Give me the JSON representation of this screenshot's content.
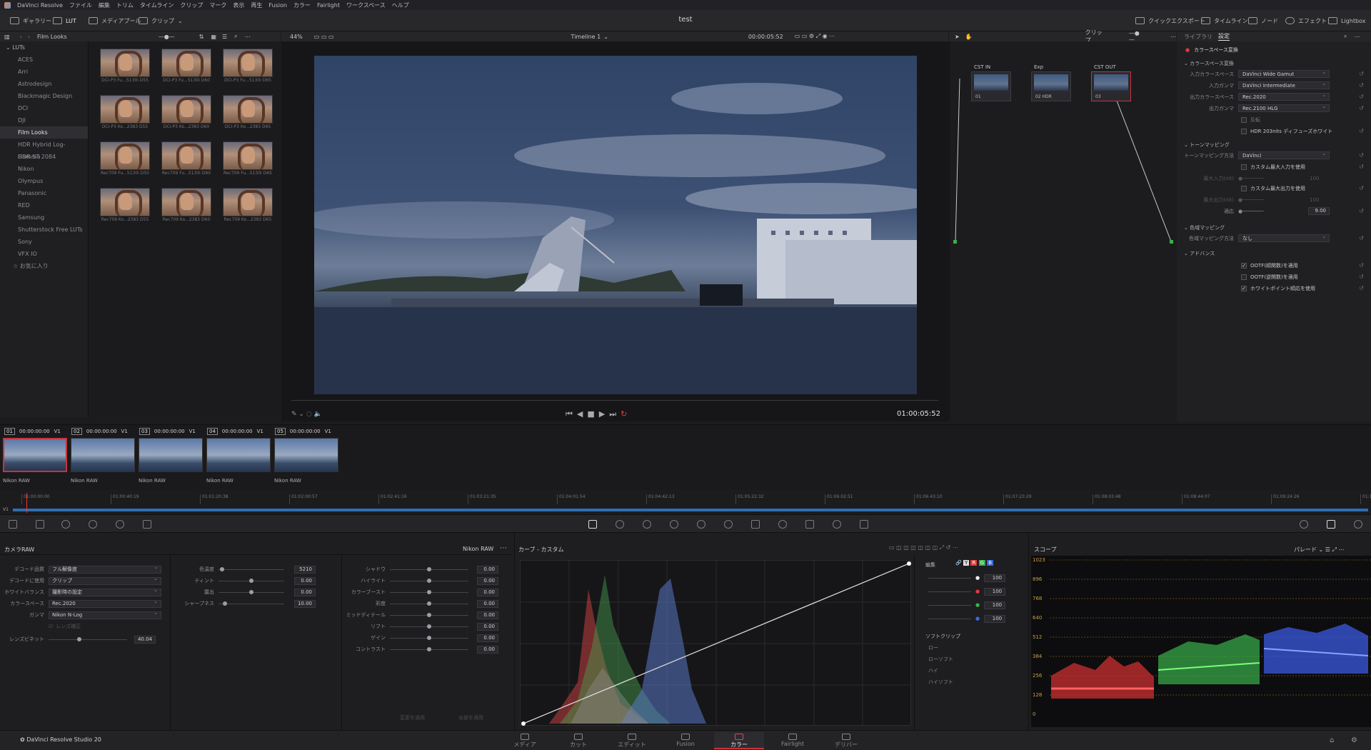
{
  "menubar": {
    "app": "DaVinci Resolve",
    "items": [
      "ファイル",
      "編集",
      "トリム",
      "タイムライン",
      "クリップ",
      "マーク",
      "表示",
      "再生",
      "Fusion",
      "カラー",
      "Fairlight",
      "ワークスペース",
      "ヘルプ"
    ]
  },
  "topbar": {
    "title": "test",
    "left": [
      "ギャラリー",
      "LUT",
      "メディアプール",
      "クリップ"
    ],
    "right": [
      "クイックエクスポート",
      "タイムライン",
      "ノード",
      "エフェクト",
      "Lightbox"
    ]
  },
  "lutbrowser": {
    "path": "Film Looks",
    "folder_root": "LUTs",
    "folders": [
      "ACES",
      "Arri",
      "Astrodesign",
      "Blackmagic Design",
      "DCI",
      "DJI",
      "Film Looks",
      "HDR Hybrid Log-Gamma",
      "HDR ST 2084",
      "Nikon",
      "Olympus",
      "Panasonic",
      "RED",
      "Samsung",
      "Shutterstock Free LUTs",
      "Sony",
      "VFX IO",
      "お気に入り"
    ],
    "selected": "Film Looks",
    "thumbs": [
      "DCI-P3 Fu...5130i D55",
      "DCI-P3 Fu...5130i D60",
      "DCI-P3 Fu...5130i D65",
      "DCI-P3 Ko...2383 D55",
      "DCI-P3 Ko...2383 D60",
      "DCI-P3 Ko...2383 D65",
      "Rec709 Fu...5130i D55",
      "Rec709 Fu...5130i D60",
      "Rec709 Fu...5130i D65",
      "Rec709 Ko...2383 D55",
      "Rec709 Ko...2383 D60",
      "Rec709 Ko...2383 D65"
    ]
  },
  "viewer": {
    "zoom": "44%",
    "timeline": "Timeline 1",
    "timecode_top": "00:00:05:52",
    "timecode": "01:00:05:52"
  },
  "nodes": {
    "mode": "クリップ",
    "items": [
      {
        "name": "CST IN",
        "label": "01"
      },
      {
        "name": "Exp",
        "label": "02 HDR"
      },
      {
        "name": "CST OUT",
        "label": "03"
      }
    ]
  },
  "settings": {
    "tabs": [
      "ライブラリ",
      "設定"
    ],
    "section": "カラースペース変換",
    "groups": {
      "csc": "カラースペース変換",
      "tone": "トーンマッピング",
      "gamut": "色域マッピング",
      "adv": "アドバンス"
    },
    "in_cs_label": "入力カラースペース",
    "in_cs": "DaVinci Wide Gamut",
    "in_gamma_label": "入力ガンマ",
    "in_gamma": "DaVinci Intermediate",
    "out_cs_label": "出力カラースペース",
    "out_cs": "Rec.2020",
    "out_gamma_label": "出力ガンマ",
    "out_gamma": "Rec.2100 HLG",
    "invert": "反転",
    "hdr203": "HDR 203nits ディフューズホワイト",
    "tm_label": "トーンマッピング方法",
    "tm": "DaVinci",
    "custom_in": "カスタム最大入力を使用",
    "max_in": "最大入力(nit)",
    "max_in_val": "100",
    "custom_out": "カスタム最大出力を使用",
    "max_out": "最大出力(nit)",
    "max_out_val": "100",
    "adapt_label": "適応",
    "adapt": "9.00",
    "gm_label": "色域マッピング方法",
    "gm": "なし",
    "ootf_fwd": "OOTF(順関数)を適用",
    "ootf_inv": "OOTF(逆関数)を適用",
    "wp": "ホワイトポイント順応を使用"
  },
  "clips": [
    {
      "num": "01",
      "tc": "00:00:00:00",
      "track": "V1",
      "name": "Nikon RAW"
    },
    {
      "num": "02",
      "tc": "00:00:00:00",
      "track": "V1",
      "name": "Nikon RAW"
    },
    {
      "num": "03",
      "tc": "00:00:00:00",
      "track": "V1",
      "name": "Nikon RAW"
    },
    {
      "num": "04",
      "tc": "00:00:00:00",
      "track": "V1",
      "name": "Nikon RAW"
    },
    {
      "num": "05",
      "tc": "00:00:00:00",
      "track": "V1",
      "name": "Nikon RAW"
    }
  ],
  "minitimeline": {
    "track": "V1",
    "ticks": [
      "01:00:00:00",
      "01:00:40:19",
      "01:01:20:38",
      "01:02:00:57",
      "01:02:41:16",
      "01:03:21:35",
      "01:04:01:54",
      "01:04:42:13",
      "01:05:22:32",
      "01:06:02:51",
      "01:06:43:10",
      "01:07:23:29",
      "01:08:03:48",
      "01:08:44:07",
      "01:09:24:26",
      "01:10:0"
    ]
  },
  "camera_raw": {
    "title": "カメラRAW",
    "clip": "Nikon RAW",
    "decode_quality_label": "デコード品質",
    "decode_quality": "フル解像度",
    "decode_using_label": "デコードに使用",
    "decode_using": "クリップ",
    "wb_label": "ホワイトバランス",
    "wb": "撮影時の設定",
    "cs_label": "カラースペース",
    "cs": "Rec.2020",
    "gamma_label": "ガンマ",
    "gamma": "Nikon N-Log",
    "lens_label": "レンズ補正",
    "vignette_label": "レンズビネット",
    "vignette": "40.04",
    "temp_label": "色温度",
    "temp": "5210",
    "tint_label": "ティント",
    "tint": "0.00",
    "exp_label": "露出",
    "exp": "0.00",
    "sharp_label": "シャープネス",
    "sharp": "10.00",
    "shadow_label": "シャドウ",
    "shadow": "0.00",
    "high_label": "ハイライト",
    "high": "0.00",
    "boost_label": "カラーブースト",
    "boost": "0.00",
    "sat_label": "彩度",
    "sat": "0.00",
    "mid_label": "ミッドディテール",
    "mid": "0.00",
    "lift_label": "リフト",
    "lift": "0.00",
    "gain_label": "ゲイン",
    "gain": "0.00",
    "contrast_label": "コントラスト",
    "contrast": "0.00",
    "btn1": "変更を適用",
    "btn2": "全部を適用"
  },
  "curves": {
    "title": "カーブ - カスタム",
    "edit": "編集",
    "vals": [
      "100",
      "100",
      "100",
      "100"
    ],
    "softclip": "ソフトクリップ",
    "low": "ロー",
    "lowsoft": "ローソフト",
    "high": "ハイ",
    "highsoft": "ハイソフト",
    "Y": "Y",
    "R": "R",
    "G": "G",
    "B": "B"
  },
  "scope": {
    "title": "スコープ",
    "mode": "パレード",
    "ticks": [
      "1023",
      "896",
      "768",
      "640",
      "512",
      "384",
      "256",
      "128",
      "0"
    ]
  },
  "pages": [
    "メディア",
    "カット",
    "エディット",
    "Fusion",
    "カラー",
    "Fairlight",
    "デリバー"
  ],
  "footer": "DaVinci Resolve Studio 20",
  "colors": {
    "accent": "#c8323a",
    "red": "#e23a3a",
    "green": "#3ab04a",
    "blue": "#3a6ae0"
  }
}
